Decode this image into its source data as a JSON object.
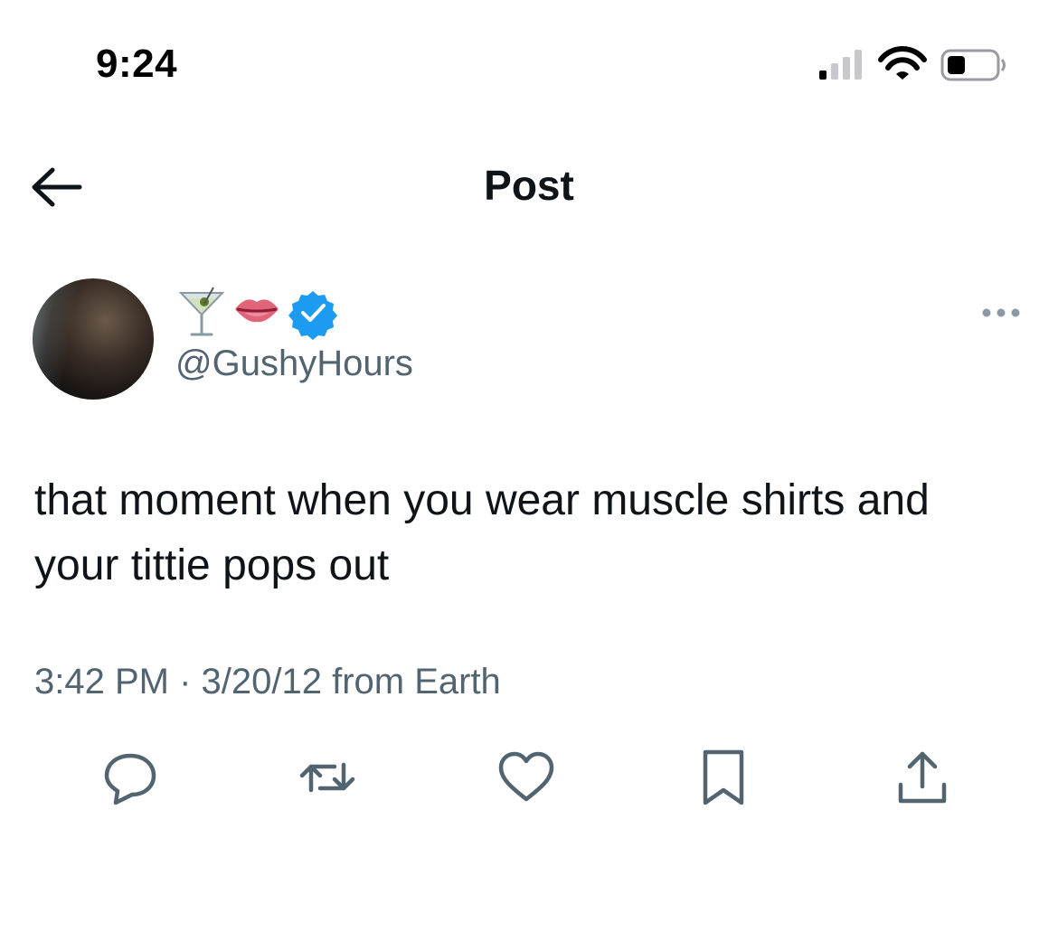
{
  "status_bar": {
    "time": "9:24",
    "icons": [
      "cellular-signal-icon",
      "wifi-icon",
      "battery-icon"
    ]
  },
  "nav": {
    "title": "Post",
    "back_icon": "arrow-left-icon"
  },
  "post": {
    "author": {
      "display_name_emojis": [
        "🍸",
        "👄"
      ],
      "verified": true,
      "handle": "@GushyHours"
    },
    "text_line1": "that moment when you wear muscle shirts and",
    "text_line2": "your tittie pops out",
    "meta": "3:42 PM · 3/20/12 from Earth"
  },
  "actions": [
    "reply-icon",
    "repost-icon",
    "like-icon",
    "bookmark-icon",
    "share-icon"
  ],
  "colors": {
    "text": "#0f1419",
    "secondary": "#536471",
    "verified_blue": "#1d9bf0",
    "background": "#ffffff"
  }
}
